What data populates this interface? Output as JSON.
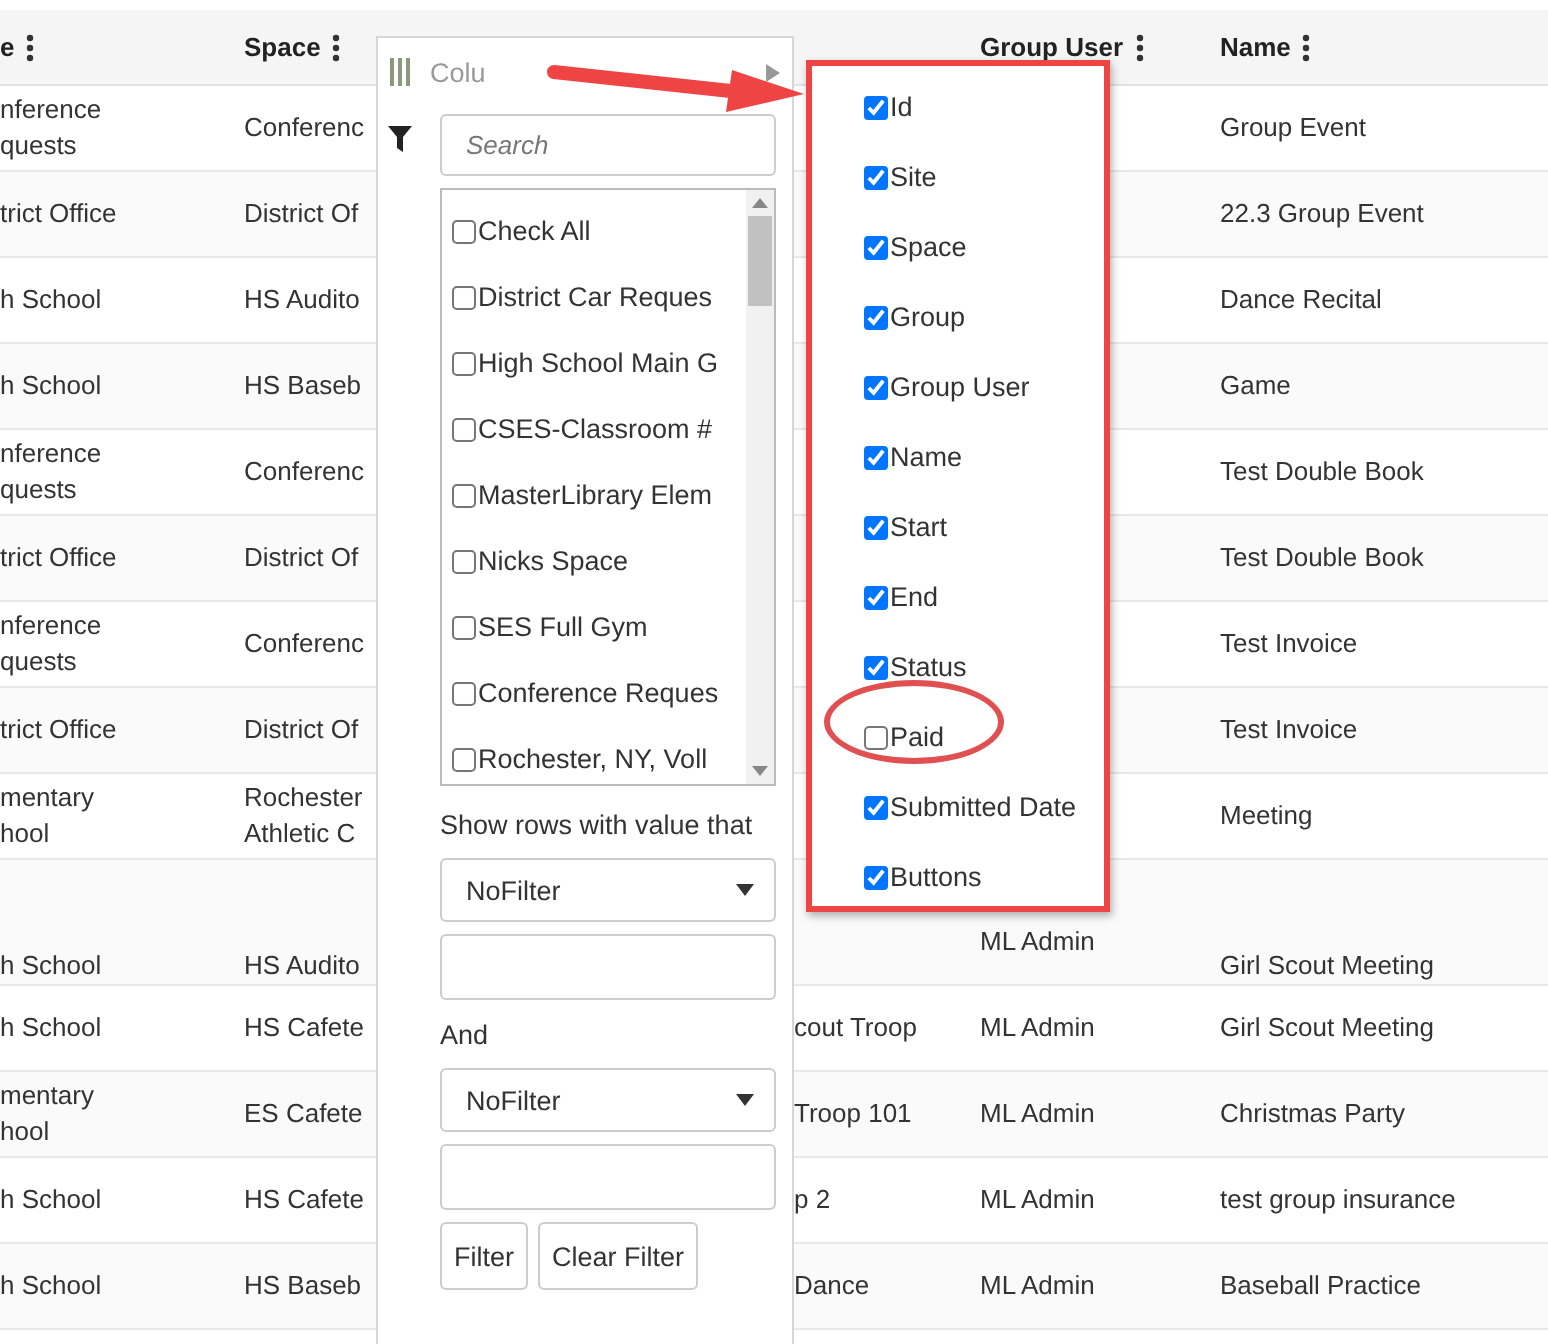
{
  "table": {
    "columns": [
      {
        "label": "e"
      },
      {
        "label": "Space"
      },
      {
        "label": "Group User"
      },
      {
        "label": "Name"
      }
    ],
    "rows": [
      {
        "column_1": "nference\nquests",
        "space": "Conferenc",
        "name": "Group Event"
      },
      {
        "column_1": "trict Office",
        "space": "District Of",
        "name": "22.3 Group Event"
      },
      {
        "column_1": "h School",
        "space": "HS Audito",
        "name": "Dance Recital"
      },
      {
        "column_1": "h School",
        "space": "HS Baseb",
        "name": "Game"
      },
      {
        "column_1": "nference\nquests",
        "space": "Conferenc",
        "name": "Test Double Book"
      },
      {
        "column_1": "trict Office",
        "space": "District Of",
        "name": "Test Double Book"
      },
      {
        "column_1": "nference\nquests",
        "space": "Conferenc",
        "name": "Test Invoice"
      },
      {
        "column_1": "trict Office",
        "space": "District Of",
        "name": "Test Invoice"
      },
      {
        "column_1": "mentary\nhool",
        "space": "Rochester\nAthletic C",
        "name": "Meeting"
      },
      {
        "column_1": "h School",
        "space": "HS Audito",
        "group_user": "ML Admin",
        "name": "Girl Scout Meeting"
      },
      {
        "column_1": "h School",
        "space": "HS Cafete",
        "column_3": "cout Troop",
        "group_user": "ML Admin",
        "name": "Girl Scout Meeting"
      },
      {
        "column_1": "mentary\nhool",
        "space": "ES Cafete",
        "column_3": "Troop 101",
        "group_user": "ML Admin",
        "name": "Christmas Party"
      },
      {
        "column_1": "h School",
        "space": "HS Cafete",
        "column_3": "p 2",
        "group_user": "ML Admin",
        "name": "test group insurance"
      },
      {
        "column_1": "h School",
        "space": "HS Baseb",
        "column_3": "Dance",
        "group_user": "ML Admin",
        "name": "Baseball Practice"
      }
    ]
  },
  "filter_menu": {
    "tab_label": "Colu",
    "search": {
      "placeholder": "Search"
    },
    "values": [
      {
        "label": "Check All",
        "checked": false
      },
      {
        "label": "District Car Reques",
        "checked": false
      },
      {
        "label": "High School Main G",
        "checked": false
      },
      {
        "label": "CSES-Classroom #",
        "checked": false
      },
      {
        "label": "MasterLibrary Elem",
        "checked": false
      },
      {
        "label": "Nicks Space",
        "checked": false
      },
      {
        "label": "SES Full Gym",
        "checked": false
      },
      {
        "label": "Conference Reques",
        "checked": false
      },
      {
        "label": "Rochester, NY, Voll",
        "checked": false
      }
    ],
    "condition_label": "Show rows with value that",
    "condition_1": "NoFilter",
    "join_label": "And",
    "condition_2": "NoFilter",
    "buttons": [
      "Filter",
      "Clear Filter"
    ]
  },
  "column_chooser": {
    "columns": [
      {
        "label": "Id",
        "checked": true
      },
      {
        "label": "Site",
        "checked": true
      },
      {
        "label": "Space",
        "checked": true
      },
      {
        "label": "Group",
        "checked": true
      },
      {
        "label": "Group User",
        "checked": true
      },
      {
        "label": "Name",
        "checked": true
      },
      {
        "label": "Start",
        "checked": true
      },
      {
        "label": "End",
        "checked": true
      },
      {
        "label": "Status",
        "checked": true
      },
      {
        "label": "Paid",
        "checked": false
      },
      {
        "label": "Submitted Date",
        "checked": true
      },
      {
        "label": "Buttons",
        "checked": true
      }
    ]
  }
}
